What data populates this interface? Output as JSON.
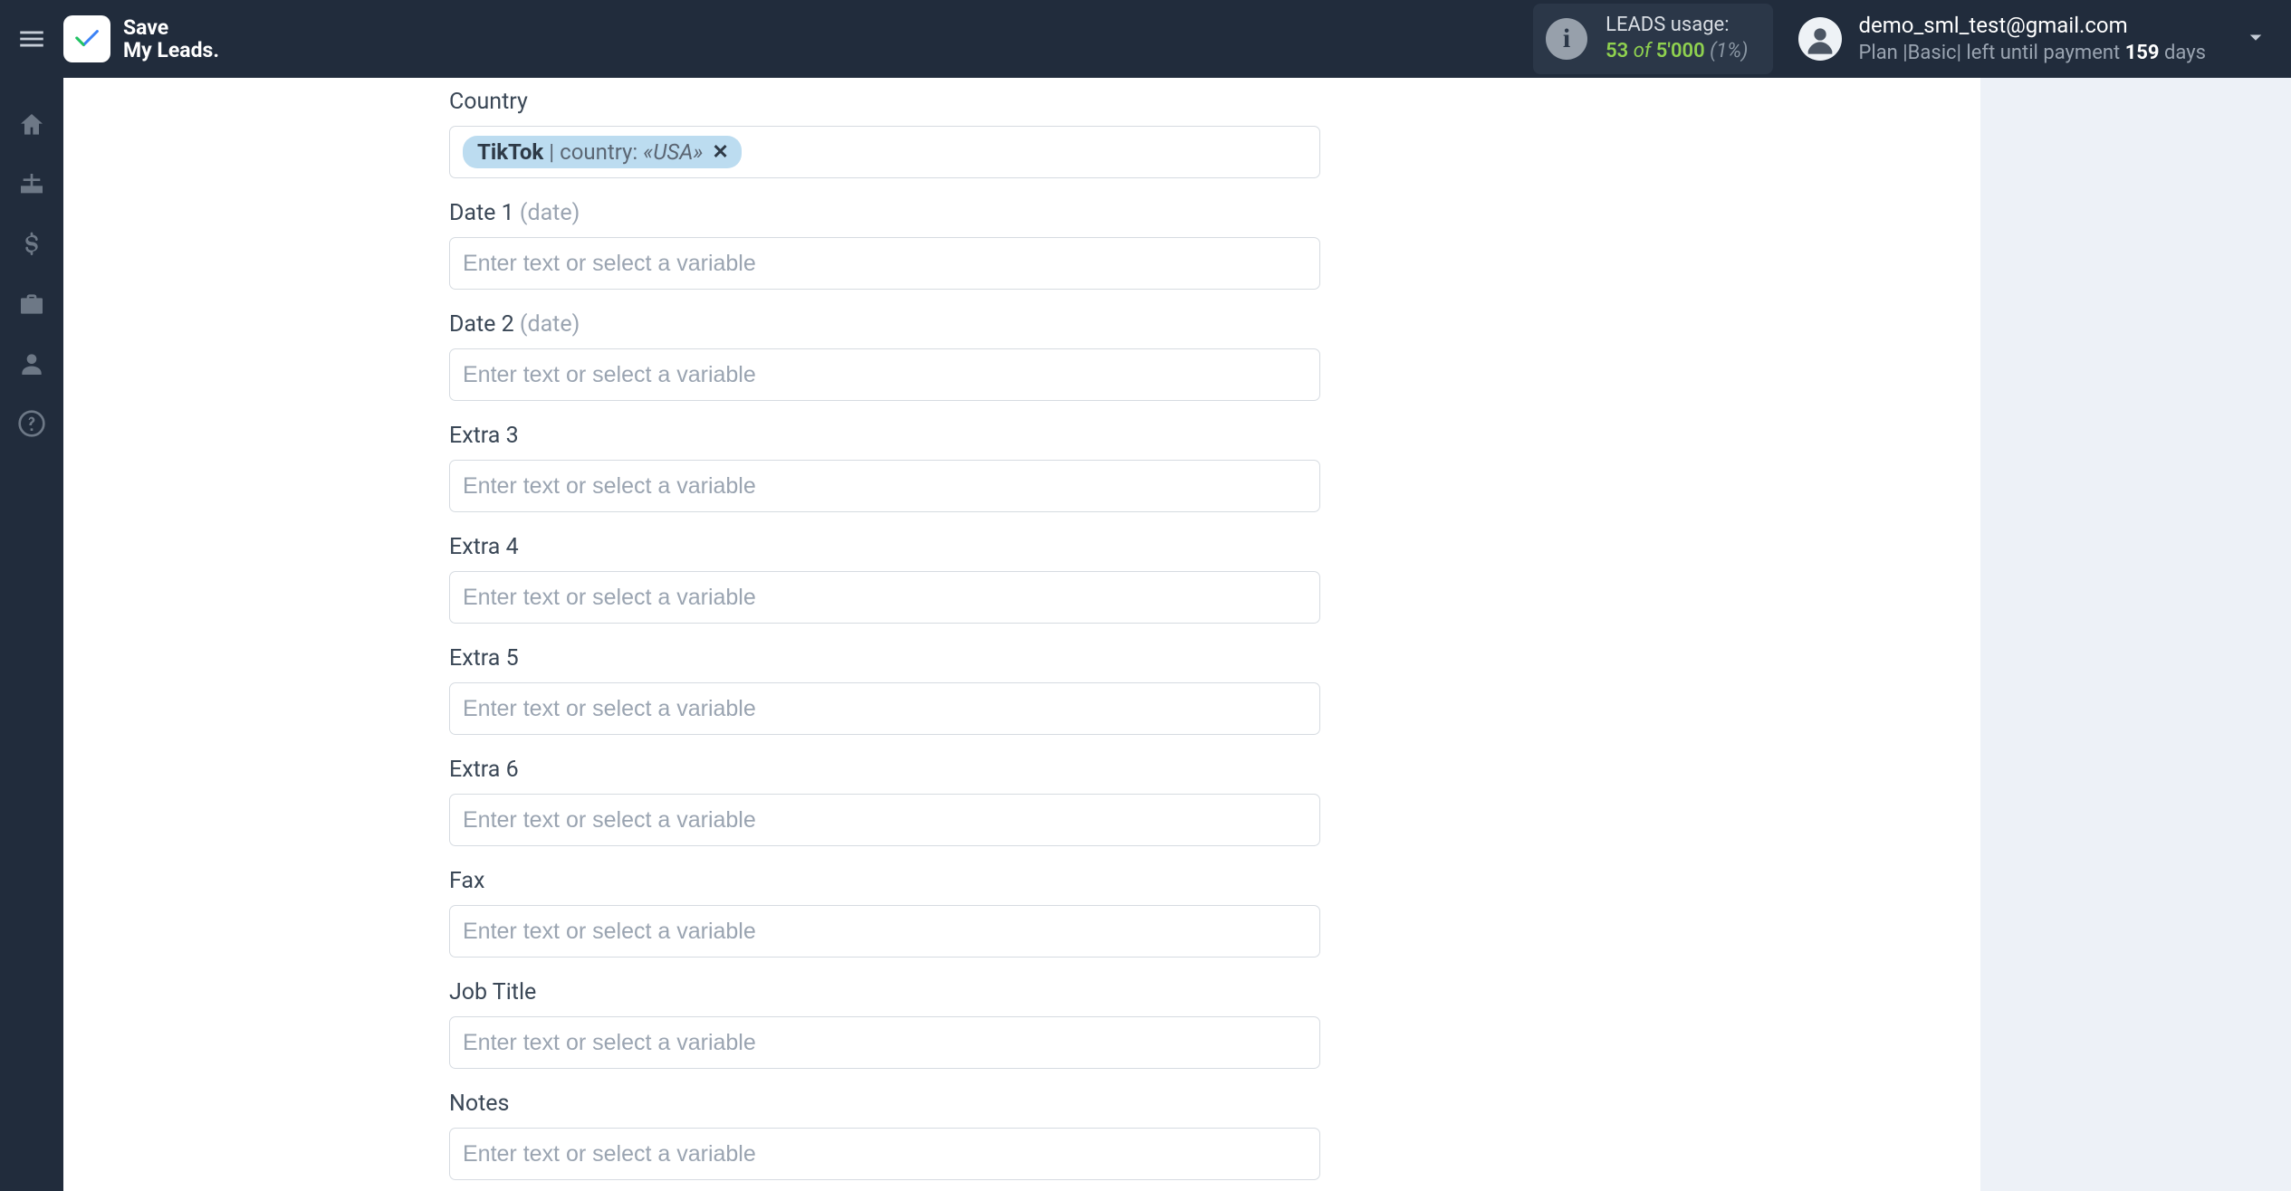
{
  "header": {
    "logo_line1": "Save",
    "logo_line2": "My Leads.",
    "usage": {
      "label": "LEADS usage:",
      "used": "53",
      "of": "of",
      "total": "5'000",
      "pct": "(1%)"
    },
    "account": {
      "email": "demo_sml_test@gmail.com",
      "plan_prefix": "Plan |",
      "plan_name": "Basic",
      "plan_suffix1": "| left until payment ",
      "days": "159",
      "days_unit": " days"
    }
  },
  "sidebar": {
    "items": [
      {
        "name": "home-icon"
      },
      {
        "name": "sitemap-icon"
      },
      {
        "name": "dollar-icon"
      },
      {
        "name": "briefcase-icon"
      },
      {
        "name": "user-icon"
      },
      {
        "name": "help-icon"
      }
    ]
  },
  "form": {
    "placeholder": "Enter text or select a variable",
    "fields": [
      {
        "label": "Country",
        "hint": "",
        "tag": {
          "source": "TikTok",
          "key": "country",
          "value": "USA"
        }
      },
      {
        "label": "Date 1",
        "hint": "(date)"
      },
      {
        "label": "Date 2",
        "hint": "(date)"
      },
      {
        "label": "Extra 3",
        "hint": ""
      },
      {
        "label": "Extra 4",
        "hint": ""
      },
      {
        "label": "Extra 5",
        "hint": ""
      },
      {
        "label": "Extra 6",
        "hint": ""
      },
      {
        "label": "Fax",
        "hint": ""
      },
      {
        "label": "Job Title",
        "hint": ""
      },
      {
        "label": "Notes",
        "hint": ""
      }
    ]
  }
}
